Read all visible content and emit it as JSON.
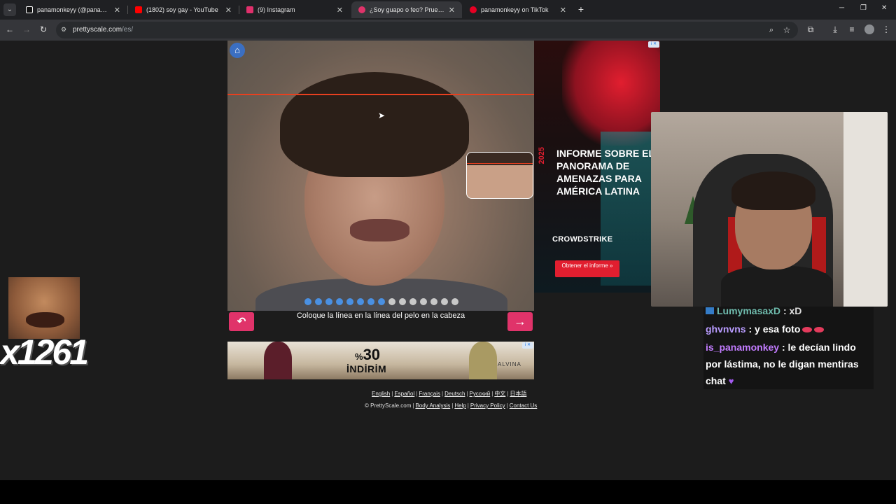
{
  "browser": {
    "tabs": [
      {
        "title": "panamonkeyy (@panamonkeyy",
        "active": false,
        "favicon_color": "#ffffff",
        "favicon": "tiktok-icon"
      },
      {
        "title": "(1802) soy gay - YouTube",
        "active": false,
        "favicon_color": "#ff0000",
        "favicon": "youtube-icon"
      },
      {
        "title": "(9) Instagram",
        "active": false,
        "favicon_color": "#e1306c",
        "favicon": "instagram-icon"
      },
      {
        "title": "¿Soy guapo o feo? Prueba de a",
        "active": true,
        "favicon_color": "#e0336a",
        "favicon": "prettyscale-icon"
      },
      {
        "title": "panamonkeyy on TikTok",
        "active": false,
        "favicon_color": "#e60023",
        "favicon": "pinterest-icon"
      }
    ],
    "new_tab_label": "+",
    "url_host": "prettyscale.com",
    "url_path": "/es/"
  },
  "camera": {
    "instruction": "Coloque la línea en la línea del pelo en la cabeza",
    "progress_steps_total": 15,
    "progress_steps_done": 8,
    "home_icon": "home-icon",
    "undo_icon": "undo-icon",
    "next_icon": "arrow-right-icon"
  },
  "ad_right": {
    "year": "2025",
    "headline": "INFORME SOBRE EL PANORAMA DE AMENAZAS PARA AMÉRICA LATINA",
    "brand": "CROWDSTRIKE",
    "cta": "Obtener el informe »"
  },
  "ad_bottom": {
    "prefix": "%",
    "number": "30",
    "word": "İNDİRİM",
    "brand": "ALVINA"
  },
  "chat": {
    "partial_top": {
      "user": "LumymasaxD",
      "text": ": xD"
    },
    "messages": [
      {
        "user": "ghvnvns",
        "text": ": y esa foto"
      },
      {
        "user": "is_panamonkey",
        "text": ": le decían lindo por lástima, no le digan mentiras chat"
      }
    ]
  },
  "meme": {
    "counter": "x1261"
  },
  "footer": {
    "languages": [
      "English",
      "Español",
      "Français",
      "Deutsch",
      "Русский",
      "中文",
      "日本語"
    ],
    "copyright": "© PrettyScale.com",
    "links": [
      "Body Analysis",
      "Help",
      "Privacy Policy",
      "Contact Us"
    ]
  },
  "colors": {
    "accent_pink": "#e0336a",
    "progress_blue": "#4a90e2",
    "hairline_red": "#e8401f",
    "crowdstrike_red": "#e11e2f"
  }
}
